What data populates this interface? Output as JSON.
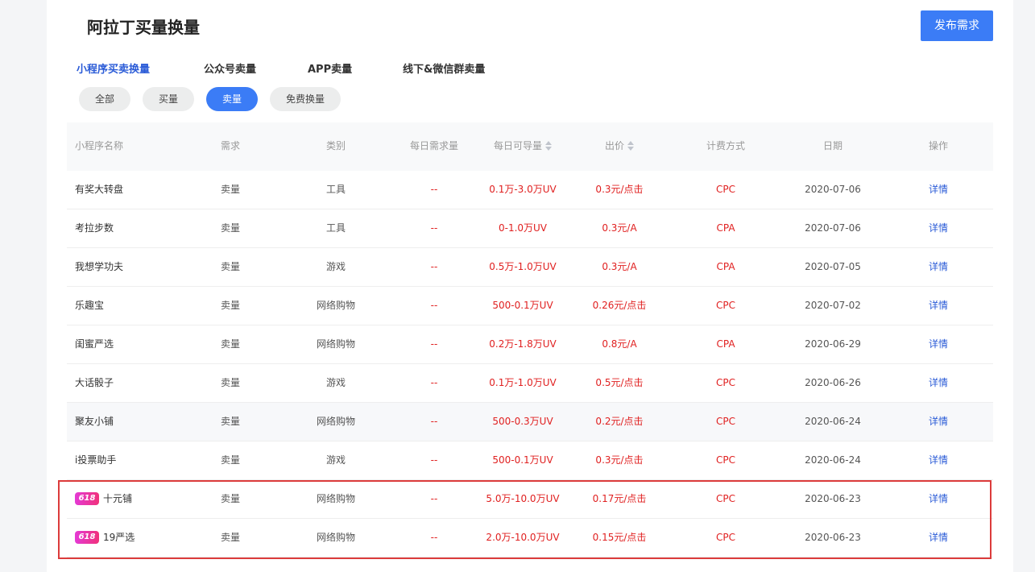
{
  "page": {
    "title": "阿拉丁买量换量",
    "publish_label": "发布需求"
  },
  "tabs": [
    "小程序买卖换量",
    "公众号卖量",
    "APP卖量",
    "线下&微信群卖量"
  ],
  "active_tab": 0,
  "filters": [
    "全部",
    "买量",
    "卖量",
    "免费换量"
  ],
  "active_filter": 2,
  "columns": [
    "小程序名称",
    "需求",
    "类别",
    "每日需求量",
    "每日可导量",
    "出价",
    "计费方式",
    "日期",
    "操作"
  ],
  "rows": [
    {
      "name": "有奖大转盘",
      "demand": "卖量",
      "category": "工具",
      "daily_need": "--",
      "daily_supply": "0.1万-3.0万UV",
      "price": "0.3元/点击",
      "billing": "CPC",
      "date": "2020-07-06",
      "action": "详情"
    },
    {
      "name": "考拉步数",
      "demand": "卖量",
      "category": "工具",
      "daily_need": "--",
      "daily_supply": "0-1.0万UV",
      "price": "0.3元/A",
      "billing": "CPA",
      "date": "2020-07-06",
      "action": "详情"
    },
    {
      "name": "我想学功夫",
      "demand": "卖量",
      "category": "游戏",
      "daily_need": "--",
      "daily_supply": "0.5万-1.0万UV",
      "price": "0.3元/A",
      "billing": "CPA",
      "date": "2020-07-05",
      "action": "详情"
    },
    {
      "name": "乐趣宝",
      "demand": "卖量",
      "category": "网络购物",
      "daily_need": "--",
      "daily_supply": "500-0.1万UV",
      "price": "0.26元/点击",
      "billing": "CPC",
      "date": "2020-07-02",
      "action": "详情"
    },
    {
      "name": "闺蜜严选",
      "demand": "卖量",
      "category": "网络购物",
      "daily_need": "--",
      "daily_supply": "0.2万-1.8万UV",
      "price": "0.8元/A",
      "billing": "CPA",
      "date": "2020-06-29",
      "action": "详情"
    },
    {
      "name": "大话骰子",
      "demand": "卖量",
      "category": "游戏",
      "daily_need": "--",
      "daily_supply": "0.1万-1.0万UV",
      "price": "0.5元/点击",
      "billing": "CPC",
      "date": "2020-06-26",
      "action": "详情"
    },
    {
      "name": "聚友小铺",
      "demand": "卖量",
      "category": "网络购物",
      "daily_need": "--",
      "daily_supply": "500-0.3万UV",
      "price": "0.2元/点击",
      "billing": "CPC",
      "date": "2020-06-24",
      "action": "详情"
    },
    {
      "name": "i投票助手",
      "demand": "卖量",
      "category": "游戏",
      "daily_need": "--",
      "daily_supply": "500-0.1万UV",
      "price": "0.3元/点击",
      "billing": "CPC",
      "date": "2020-06-24",
      "action": "详情"
    },
    {
      "badge": "618",
      "name": "十元铺",
      "demand": "卖量",
      "category": "网络购物",
      "daily_need": "--",
      "daily_supply": "5.0万-10.0万UV",
      "price": "0.17元/点击",
      "billing": "CPC",
      "date": "2020-06-23",
      "action": "详情"
    },
    {
      "badge": "618",
      "name": "19严选",
      "demand": "卖量",
      "category": "网络购物",
      "daily_need": "--",
      "daily_supply": "2.0万-10.0万UV",
      "price": "0.15元/点击",
      "billing": "CPC",
      "date": "2020-06-23",
      "action": "详情"
    }
  ],
  "highlighted_row": 6,
  "colors": {
    "accent": "#3b7cf6",
    "red": "#e02020",
    "link": "#2a5bd7",
    "box": "#dc3b3b"
  }
}
